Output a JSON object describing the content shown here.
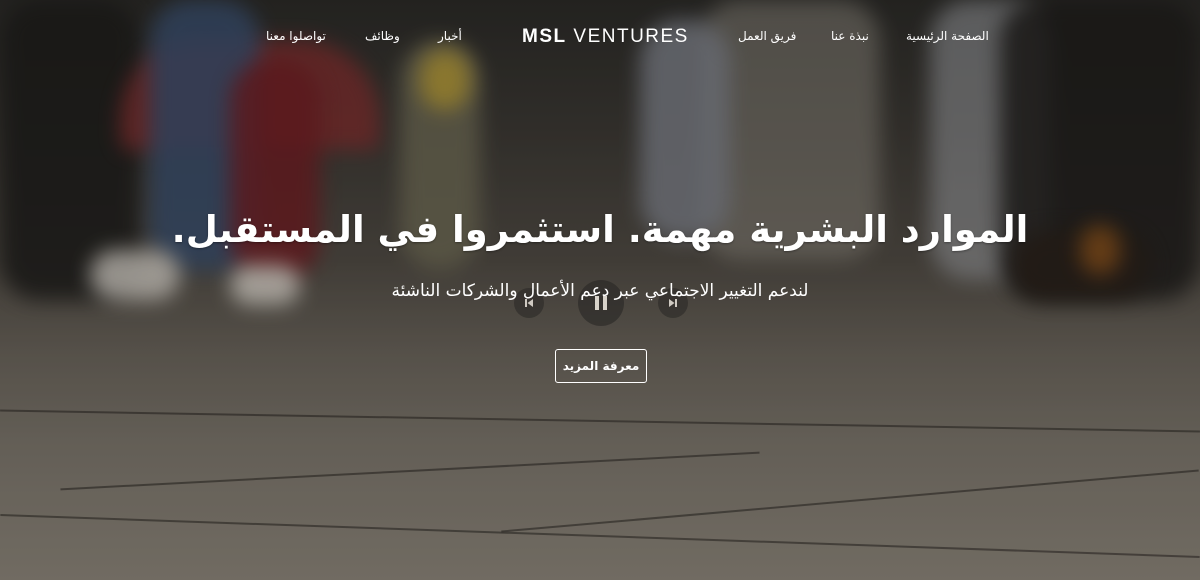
{
  "nav": {
    "logo_bold": "MSL",
    "logo_rest": "VENTURES",
    "items": [
      {
        "label": "الصفحة الرئيسية"
      },
      {
        "label": "نبذة عنا"
      },
      {
        "label": "فريق العمل"
      },
      {
        "label": "أخبار"
      },
      {
        "label": "وظائف"
      },
      {
        "label": "تواصلوا معنا"
      }
    ]
  },
  "hero": {
    "headline": "الموارد البشرية مهمة. استثمروا في المستقبل.",
    "subline": "لندعم التغيير الاجتماعي عبر دعم الأعمال والشركات الناشئة",
    "cta_label": "معرفة المزيد"
  },
  "video_controls": {
    "prev_icon": "previous-icon",
    "pause_icon": "pause-icon",
    "next_icon": "next-icon"
  },
  "colors": {
    "text": "#ffffff",
    "overlay": "#3a3631"
  }
}
